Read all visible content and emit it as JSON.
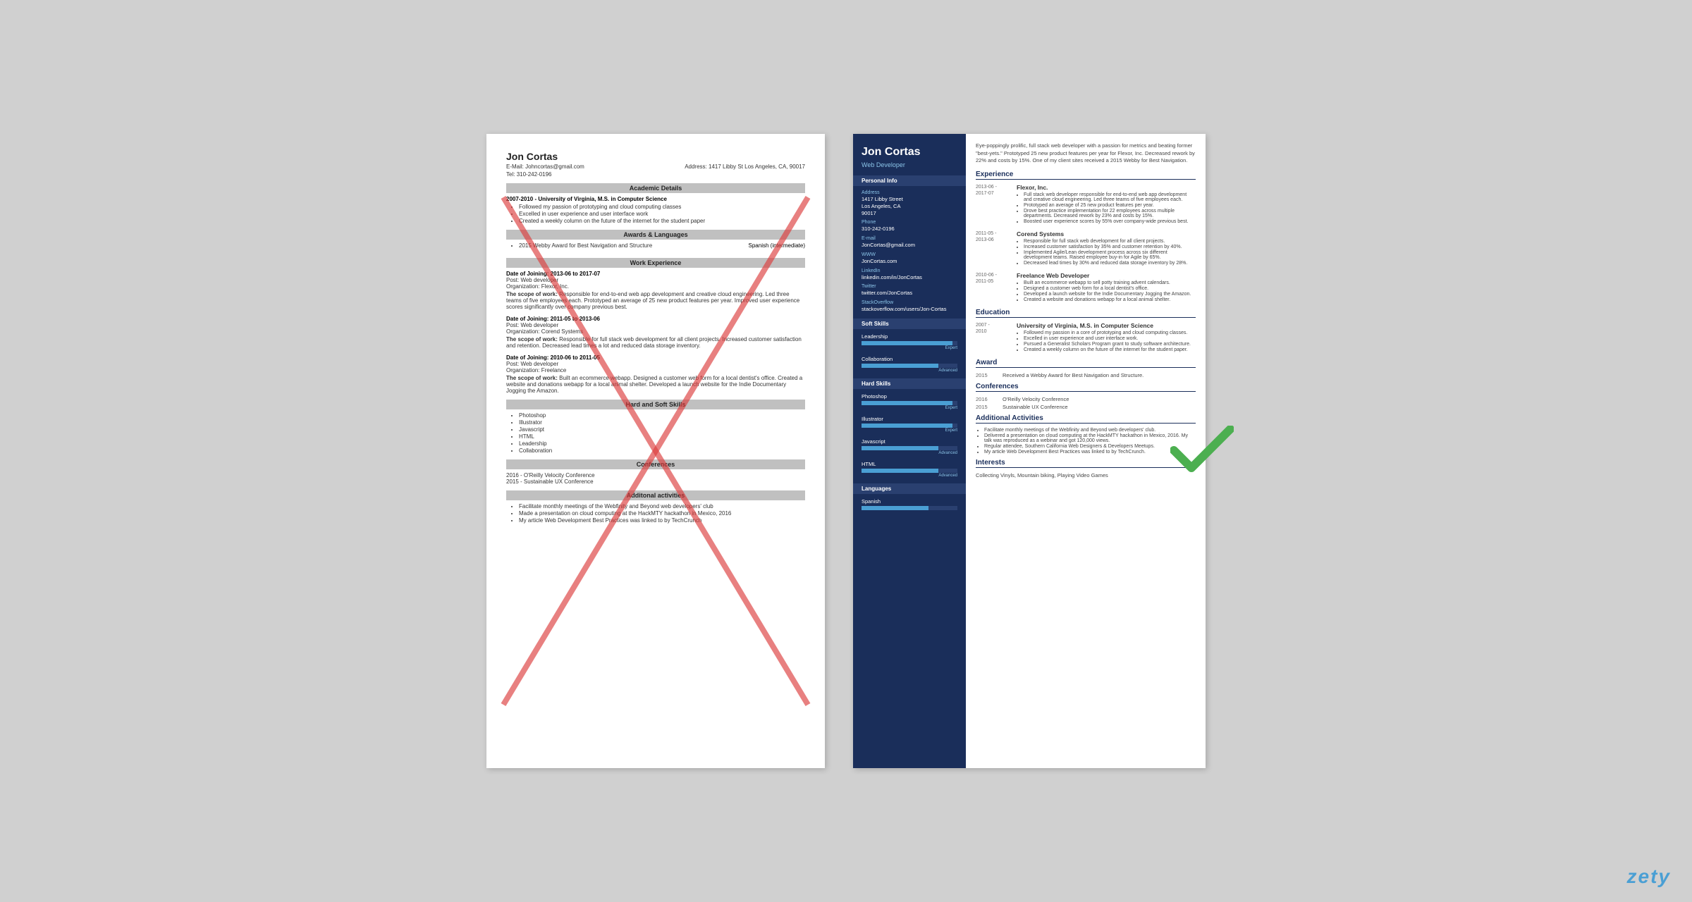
{
  "left_resume": {
    "name": "Jon Cortas",
    "email_label": "E-Mail:",
    "email": "Johncortas@gmail.com",
    "address_label": "Address:",
    "address": "1417 Libby St Los Angeles, CA, 90017",
    "tel_label": "Tel:",
    "tel": "310-242-0196",
    "sections": {
      "academic": "Academic Details",
      "awards": "Awards & Languages",
      "work": "Work Experience",
      "skills": "Hard and Soft Skills",
      "conferences": "Conferences",
      "activities": "Additonal activities"
    },
    "academic": {
      "period": "2007-2010 - University of Virginia, M.S. in Computer Science",
      "bullets": [
        "Followed my passion of prototyping and cloud computing classes",
        "Excelled in user experience and user interface work",
        "Created a weekly column on the future of the internet for the student paper"
      ]
    },
    "awards_bullets": [
      "2015 Webby Award for Best Navigation and Structure"
    ],
    "awards_lang": "Spanish (intermediate)",
    "work_entries": [
      {
        "date": "Date of Joining: 2013-06 to 2017-07",
        "post": "Post: Web developer",
        "org": "Organization: Flexor, Inc.",
        "scope_label": "The scope of work:",
        "scope": "Responsible for end-to-end web app development and creative cloud engineering. Led three teams of five employees each. Prototyped an average of 25 new product features per year. Improved user experience scores significantly over company previous best."
      },
      {
        "date": "Date of Joining: 2011-05 to 2013-06",
        "post": "Post: Web developer",
        "org": "Organization: Corend Systems",
        "scope_label": "The scope of work:",
        "scope": "Responsible for full stack web development for all client projects. Increased customer satisfaction and retention. Decreased lead times a lot and reduced data storage inventory."
      },
      {
        "date": "Date of Joining: 2010-06 to 2011-05",
        "post": "Post: Web developer",
        "org": "Organization: Freelance",
        "scope_label": "The scope of work:",
        "scope": "Built an ecommerce webapp. Designed a customer web form for a local dentist's office. Created a website and donations webapp for a local animal shelter. Developed a launch website for the Indie Documentary Jogging the Amazon."
      }
    ],
    "skills_bullets": [
      "Photoshop",
      "Illustrator",
      "Javascript",
      "HTML",
      "Leadership",
      "Collaboration"
    ],
    "conferences": [
      "2016 - O'Reilly Velocity Conference",
      "2015 - Sustainable UX Conference"
    ],
    "activities_bullets": [
      "Facilitate monthly meetings of the Webfinity and Beyond web developers' club",
      "Made a presentation on cloud computing at the HackMTY hackathon in Mexico, 2016",
      "My article Web Development Best Practices was linked to by TechCrunch"
    ]
  },
  "right_resume": {
    "name": "Jon Cortas",
    "title": "Web Developer",
    "summary": "Eye-poppingly prolific, full stack web developer with a passion for metrics and beating former \"best-yets.\" Prototyped 25 new product features per year for Flexor, Inc. Decreased rework by 22% and costs by 15%. One of my client sites received a 2015 Webby for Best Navigation.",
    "personal_info_title": "Personal Info",
    "address_label": "Address",
    "address_value": "1417 Libby Street\nLos Angeles, CA\n90017",
    "phone_label": "Phone",
    "phone_value": "310-242-0196",
    "email_label": "E-mail",
    "email_value": "JonCortas@gmail.com",
    "www_label": "WWW",
    "www_value": "JonCortas.com",
    "linkedin_label": "LinkedIn",
    "linkedin_value": "linkedin.com/in/JonCortas",
    "twitter_label": "Twitter",
    "twitter_value": "twitter.com/JonCortas",
    "stackoverflow_label": "StackOverflow",
    "stackoverflow_value": "stackoverflow.com/users/Jon-Cortas",
    "soft_skills_title": "Soft Skills",
    "soft_skills": [
      {
        "name": "Leadership",
        "level": 95,
        "label": "Expert"
      },
      {
        "name": "Collaboration",
        "level": 80,
        "label": "Advanced"
      }
    ],
    "hard_skills_title": "Hard Skills",
    "hard_skills": [
      {
        "name": "Photoshop",
        "level": 95,
        "label": "Expert"
      },
      {
        "name": "Illustrator",
        "level": 95,
        "label": "Expert"
      },
      {
        "name": "Javascript",
        "level": 80,
        "label": "Advanced"
      },
      {
        "name": "HTML",
        "level": 80,
        "label": "Advanced"
      }
    ],
    "languages_title": "Languages",
    "languages": [
      {
        "name": "Spanish",
        "level": 70,
        "label": ""
      }
    ],
    "experience_title": "Experience",
    "experience": [
      {
        "date": "2013-06 -\n2017-07",
        "org": "Flexor, Inc.",
        "bullets": [
          "Full stack web developer responsible for end-to-end web app development and creative cloud engineering. Led three teams of five employees each.",
          "Prototyped an average of 25 new product features per year.",
          "Drove best practice implementation for 22 employees across multiple departments. Decreased rework by 23% and costs by 15%.",
          "Boosted user experience scores by 55% over company-wide previous best."
        ]
      },
      {
        "date": "2011-05 -\n2013-06",
        "org": "Corend Systems",
        "bullets": [
          "Responsible for full stack web development for all client projects.",
          "Increased customer satisfaction by 35% and customer retention by 40%.",
          "Implemented Agile/Lean development process across six different development teams. Raised employee buy-in for Agile by 65%.",
          "Decreased lead times by 30% and reduced data storage inventory by 28%."
        ]
      },
      {
        "date": "2010-06 -\n2011-05",
        "org": "Freelance Web Developer",
        "bullets": [
          "Built an ecommerce webapp to sell potty training advent calendars.",
          "Designed a customer web form for a local dentist's office.",
          "Developed a launch website for the Indie Documentary Jogging the Amazon.",
          "Created a website and donations webapp for a local animal shelter."
        ]
      }
    ],
    "education_title": "Education",
    "education": [
      {
        "date": "2007 -\n2010",
        "org": "University of Virginia, M.S. in Computer Science",
        "bullets": [
          "Followed my passion in a core of prototyping and cloud computing classes.",
          "Excelled in user experience and user interface work.",
          "Pursued a Generalist Scholars Program grant to study software architecture.",
          "Created a weekly column on the future of the internet for the student paper."
        ]
      }
    ],
    "award_title": "Award",
    "award": {
      "year": "2015",
      "text": "Received a Webby Award for Best Navigation and Structure."
    },
    "conferences_title": "Conferences",
    "conferences": [
      {
        "year": "2016",
        "name": "O'Reilly Velocity Conference"
      },
      {
        "year": "2015",
        "name": "Sustainable UX Conference"
      }
    ],
    "activities_title": "Additional Activities",
    "activities_bullets": [
      "Facilitate monthly meetings of the Webfinity and Beyond web developers' club.",
      "Delivered a presentation on cloud computing at the HackMTY hackathon in Mexico, 2016. My talk was reproduced as a webinar and got 120,000 views.",
      "Regular attendee, Southern California Web Designers & Developers Meetups.",
      "My article Web Development Best Practices was linked to by TechCrunch."
    ],
    "interests_title": "Interests",
    "interests": "Collecting Vinyls, Mountain biking, Playing Video Games"
  },
  "expert_collab_label": "Expert Collaboration",
  "watermark": "zety"
}
